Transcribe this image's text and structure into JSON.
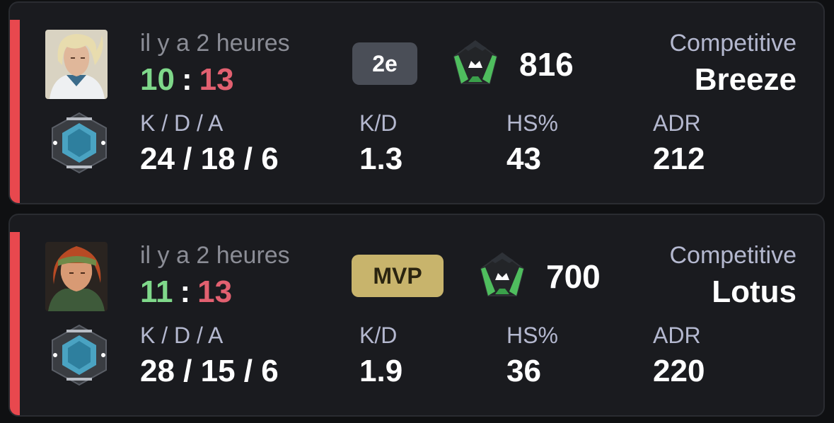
{
  "matches": [
    {
      "time_ago": "il y a 2 heures",
      "score_won": "10",
      "score_sep": ":",
      "score_lost": "13",
      "badge": "2e",
      "rr": "816",
      "mode": "Competitive",
      "map": "Breeze",
      "agent_icon": "agent-portrait-icon",
      "rank_icon": "rank-icon",
      "rr_icon": "rr-rating-icon",
      "result_color": "#e8484e",
      "stats": {
        "kda_label": "K / D / A",
        "kda_value": "24 / 18 / 6",
        "kd_label": "K/D",
        "kd_value": "1.3",
        "hs_label": "HS%",
        "hs_value": "43",
        "adr_label": "ADR",
        "adr_value": "212"
      }
    },
    {
      "time_ago": "il y a 2 heures",
      "score_won": "11",
      "score_sep": ":",
      "score_lost": "13",
      "badge": "MVP",
      "rr": "700",
      "mode": "Competitive",
      "map": "Lotus",
      "agent_icon": "agent-portrait-icon",
      "rank_icon": "rank-icon",
      "rr_icon": "rr-rating-icon",
      "result_color": "#e8484e",
      "stats": {
        "kda_label": "K / D / A",
        "kda_value": "28 / 15 / 6",
        "kd_label": "K/D",
        "kd_value": "1.9",
        "hs_label": "HS%",
        "hs_value": "36",
        "adr_label": "ADR",
        "adr_value": "220"
      }
    }
  ]
}
